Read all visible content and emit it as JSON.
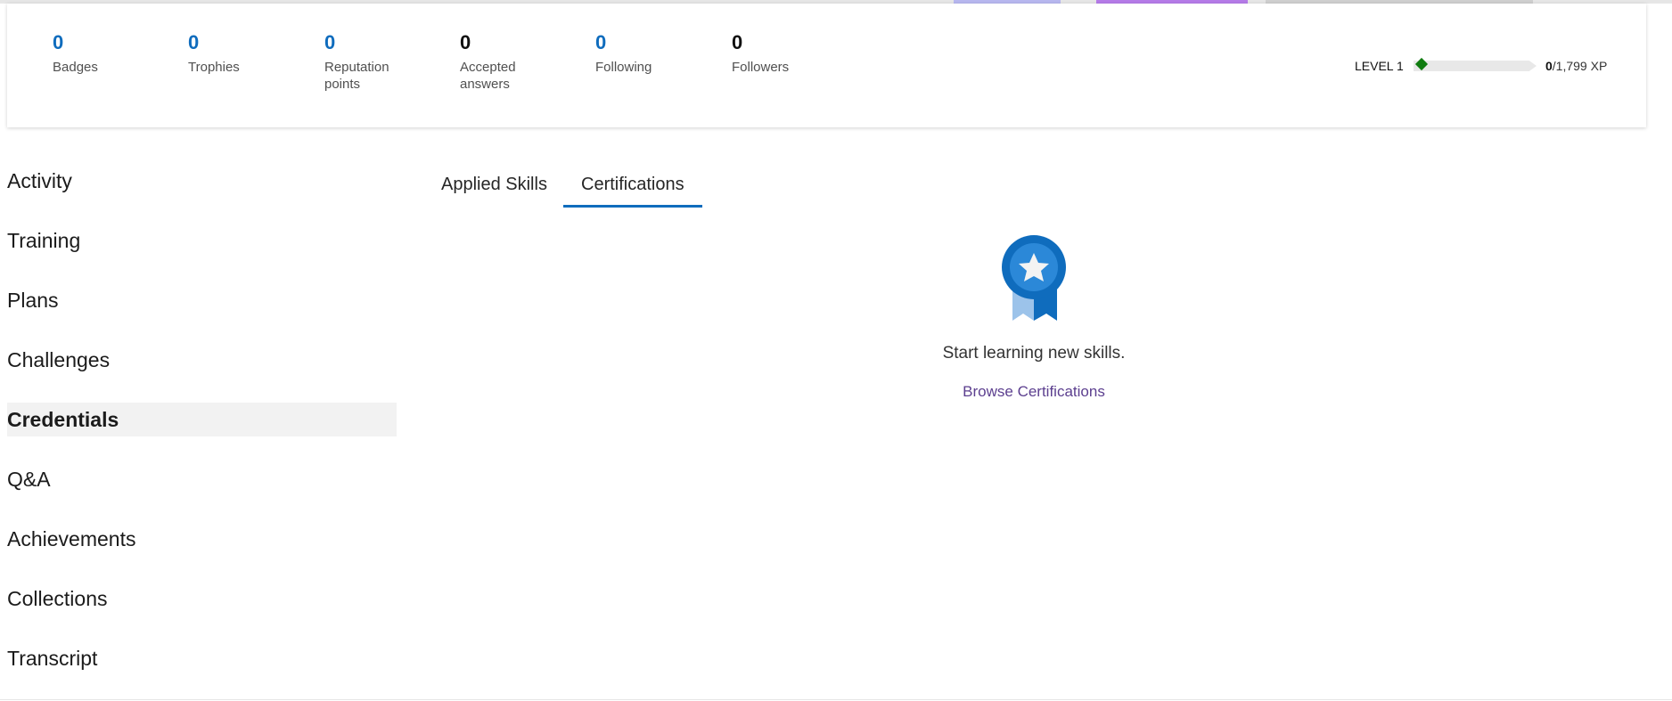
{
  "stats": [
    {
      "value": "0",
      "label": "Badges"
    },
    {
      "value": "0",
      "label": "Trophies"
    },
    {
      "value": "0",
      "label": "Reputation points"
    },
    {
      "value": "0",
      "label": "Accepted answers"
    },
    {
      "value": "0",
      "label": "Following"
    },
    {
      "value": "0",
      "label": "Followers"
    }
  ],
  "level": {
    "label": "LEVEL 1",
    "xp_current": "0",
    "xp_total": "/1,799 XP",
    "progress_fraction": 0
  },
  "sidenav": {
    "items": [
      {
        "label": "Activity"
      },
      {
        "label": "Training"
      },
      {
        "label": "Plans"
      },
      {
        "label": "Challenges"
      },
      {
        "label": "Credentials"
      },
      {
        "label": "Q&A"
      },
      {
        "label": "Achievements"
      },
      {
        "label": "Collections"
      },
      {
        "label": "Transcript"
      }
    ],
    "active": "Credentials"
  },
  "tabs": [
    {
      "label": "Applied Skills"
    },
    {
      "label": "Certifications"
    }
  ],
  "active_tab": "Certifications",
  "empty_state": {
    "icon": "certification-ribbon-icon",
    "message": "Start learning new skills.",
    "link": "Browse Certifications"
  },
  "colors": {
    "accent": "#0f6cbd",
    "progress": "#107c10",
    "link": "#5c3f8f"
  }
}
